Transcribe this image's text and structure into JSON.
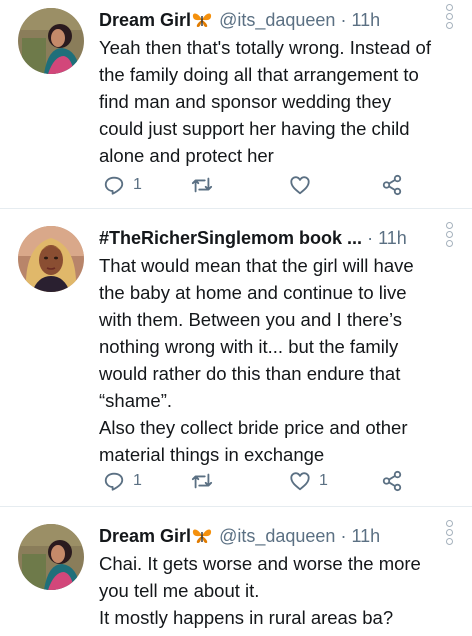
{
  "tweets": [
    {
      "name": "Dream Girl",
      "handle": "@its_daqueen",
      "time": "11h",
      "lines": [
        "Yeah then that's totally wrong. Instead of",
        "the family doing all that arrangement to",
        "find man and sponsor wedding they",
        "could just support her having the child",
        "alone and protect her"
      ],
      "replies": "1",
      "retweets": "",
      "likes": ""
    },
    {
      "name": "#TheRicherSinglemom book ...",
      "handle": "",
      "time": "11h",
      "lines": [
        "That would mean that the girl will have",
        "the baby at home and continue to live",
        "with them. Between you and I there’s",
        "nothing wrong with it... but the family",
        "would rather do this than endure that",
        "“shame”.",
        "Also they collect bride price and other",
        "material things in exchange"
      ],
      "replies": "1",
      "retweets": "",
      "likes": "1"
    },
    {
      "name": "Dream Girl",
      "handle": "@its_daqueen",
      "time": "11h",
      "lines": [
        "Chai. It gets worse and worse the more",
        "you tell me about it.",
        "It mostly happens in rural areas ba?"
      ]
    }
  ],
  "separator": "·",
  "icons": {
    "reply": "reply-icon",
    "retweet": "retweet-icon",
    "like": "heart-icon",
    "share": "share-icon",
    "emoji": "butterfly-icon",
    "menu": "more-options-icon"
  },
  "colors": {
    "text": "#14171a",
    "secondary": "#5b7083",
    "divider": "#e6ecf0"
  }
}
